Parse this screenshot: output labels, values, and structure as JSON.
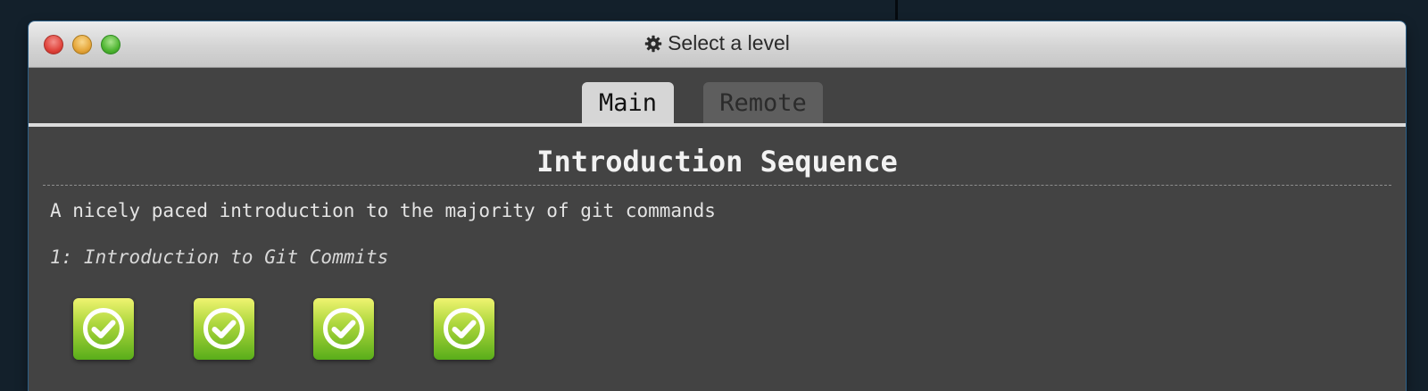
{
  "window": {
    "title": "Select a level",
    "title_icon": "gear-icon",
    "traffic_lights": [
      "close",
      "minimize",
      "maximize"
    ]
  },
  "tabs": [
    {
      "label": "Main",
      "active": true
    },
    {
      "label": "Remote",
      "active": false
    }
  ],
  "sequence": {
    "title": "Introduction Sequence",
    "description": "A nicely paced introduction to the majority of git commands",
    "section_title": "1: Introduction to Git Commits",
    "levels": [
      {
        "status": "completed",
        "icon": "checkmark-icon"
      },
      {
        "status": "completed",
        "icon": "checkmark-icon"
      },
      {
        "status": "completed",
        "icon": "checkmark-icon"
      },
      {
        "status": "completed",
        "icon": "checkmark-icon"
      }
    ]
  },
  "colors": {
    "window_bg": "#434343",
    "active_tab": "#d6d6d6",
    "inactive_tab": "#5e5e5e",
    "level_complete": "#6dbb1f"
  }
}
